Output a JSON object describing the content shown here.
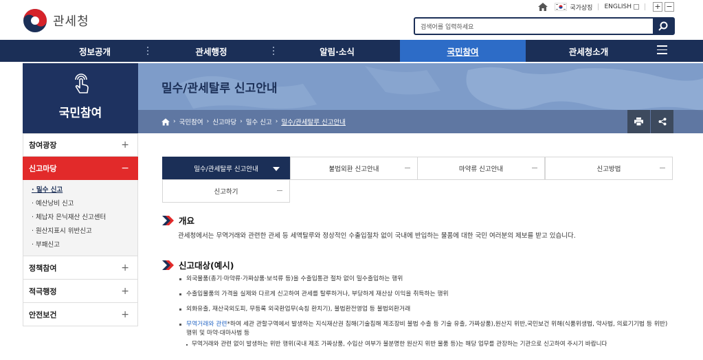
{
  "site": {
    "logo_text": "관세청"
  },
  "util": {
    "symbol_label": "국가상징",
    "english_label": "ENGLISH",
    "zoom_in": "+",
    "zoom_out": "−"
  },
  "search": {
    "placeholder": "검색어를 입력하세요"
  },
  "gnb": {
    "items": [
      {
        "label": "정보공개"
      },
      {
        "label": "관세행정"
      },
      {
        "label": "알림·소식"
      },
      {
        "label": "국민참여"
      },
      {
        "label": "관세청소개"
      }
    ]
  },
  "side": {
    "title": "국민참여",
    "items": [
      {
        "label": "참여광장",
        "sign": "+"
      },
      {
        "label": "신고마당",
        "sign": "−"
      },
      {
        "label": "정책참여",
        "sign": "+"
      },
      {
        "label": "적극행정",
        "sign": "+"
      },
      {
        "label": "안전보건",
        "sign": "+"
      }
    ],
    "sub_items": [
      {
        "label": "· 밀수 신고"
      },
      {
        "label": "· 예산낭비 신고"
      },
      {
        "label": "· 체납자 은닉재산 신고센터"
      },
      {
        "label": "· 원산지표시 위반신고"
      },
      {
        "label": "· 부패신고"
      }
    ]
  },
  "banner": {
    "page_title": "밀수/관세탈루 신고안내",
    "breadcrumb": [
      "국민참여",
      "신고마당",
      "밀수 신고",
      "밀수/관세탈루 신고안내"
    ]
  },
  "tabs": [
    {
      "label": "밀수/관세탈루 신고안내"
    },
    {
      "label": "불법외환 신고안내"
    },
    {
      "label": "마약류 신고안내"
    },
    {
      "label": "신고방법"
    },
    {
      "label": "신고하기"
    }
  ],
  "overview": {
    "title": "개요",
    "text": "관세청에서는 무역거래와 관련한 관세 등 세액탈루와 정상적인 수출입절차 없이 국내에 반입하는 물품에 대한 국민 여러분의 제보를 받고 있습니다."
  },
  "targets": {
    "title": "신고대상(예시)",
    "items": [
      "외국물품(총기·마약류·가짜상품·보석류 등)을 수출입통관 절차 없이 밀수출입하는 행위",
      "수출입물품의 가격을 실제와 다르게 신고하여 관세를 탈루하거나, 부당하게 재산상 이익을 취득하는 행위",
      "외화유출, 재산국외도피, 무등록 외국환업무(속칭 환치기), 불법환전영업 등 불법외환거래"
    ],
    "link_item": {
      "link_text": "무역거래와 관련",
      "rest_line1": "*하여 세관 관할구역에서 발생하는 지식재산권 침해(기술침해 제조장비 불법 수출 등 기술 유출, 가짜상품),원산지 위반,국민보건 위해(식품위생법, 약사법, 의료기기법 등 위반)",
      "rest_line2": "행위 및 마약·대마사범 등"
    },
    "sub_item": "무역거래와 관련 없이 발생하는 위반 행위(국내 제조 가짜상품, 수입산 여부가 불분명한 원산지 위반 물품 등)는 해당 업무를 관장하는 기관으로 신고하여 주시기 바랍니다"
  },
  "colors": {
    "navy": "#1b2f57",
    "active_blue": "#2d6cc7",
    "red": "#e22a2a"
  }
}
